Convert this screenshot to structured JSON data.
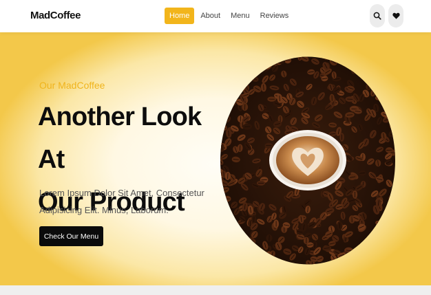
{
  "header": {
    "logo": "MadCoffee",
    "nav": [
      {
        "label": "Home",
        "active": true
      },
      {
        "label": "About",
        "active": false
      },
      {
        "label": "Menu",
        "active": false
      },
      {
        "label": "Reviews",
        "active": false
      }
    ],
    "icons": [
      "search-icon",
      "heart-icon"
    ]
  },
  "hero": {
    "eyebrow": "Our MadCoffee",
    "title_line1": "Another Look At",
    "title_line2": "Our Product",
    "description_line1": "Lorem Ipsum Dolor Sit Amet, Consectetur",
    "description_line2": "Adipisicing Elit. Minus, Laborum.",
    "cta_label": "Check Our Menu",
    "image": "coffee-beans-latte-image"
  },
  "colors": {
    "accent": "#f2b51b",
    "hero_glow": "#f3c84a",
    "cta_background": "#0b0b0b",
    "bean_dark": "#2a140a"
  }
}
